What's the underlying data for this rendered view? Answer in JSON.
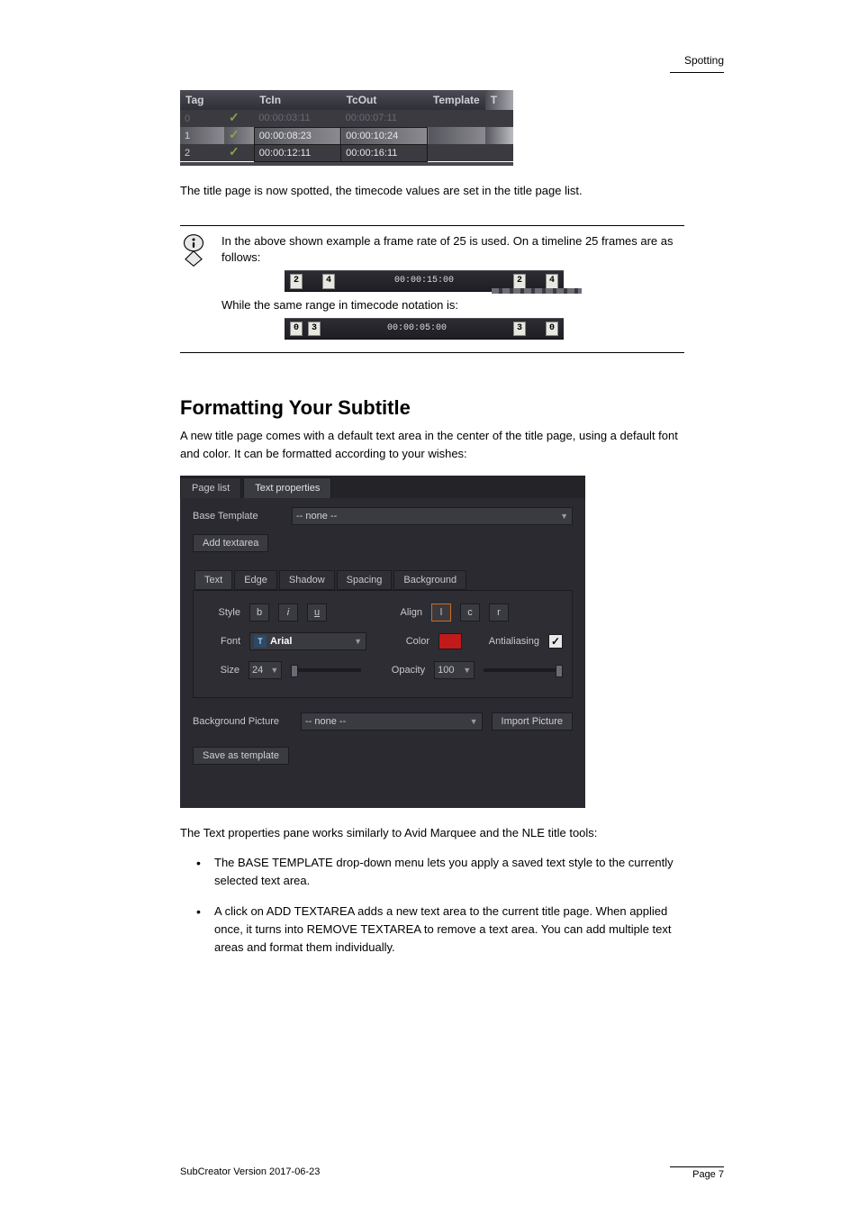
{
  "header": {
    "label": "Spotting"
  },
  "page_list": {
    "headers": [
      "Tag",
      "",
      "TcIn",
      "TcOut",
      "Template",
      "T"
    ],
    "rows": [
      {
        "tag": "0",
        "tcin": "00:00:03:11",
        "tcout": "00:00:07:11"
      },
      {
        "tag": "1",
        "tcin": "00:00:08:23",
        "tcout": "00:00:10:24"
      },
      {
        "tag": "2",
        "tcin": "00:00:12:11",
        "tcout": "00:00:16:11"
      }
    ]
  },
  "note": {
    "line1": "In the above shown example a frame rate of 25 is used. On a timeline 25 frames are as follows:",
    "line2": "While the same range in timecode notation is:"
  },
  "timeline1": {
    "left1": "2",
    "leftpad": "",
    "left2": "4",
    "center": "00:00:15:00",
    "right1": "2",
    "right2": "4"
  },
  "timeline2": {
    "left1": "0",
    "left2": "3",
    "center": "00:00:05:00",
    "right1": "3",
    "right2": "0"
  },
  "section_heading": "Formatting Your Subtitle",
  "paragraphs": {
    "p1": "A new title page comes with a default text area in the center of the title page, using a default font and color. It can be formatted according to your wishes:",
    "p2": "The Text properties pane works similarly to Avid Marquee and the NLE title tools:"
  },
  "text_properties": {
    "tabs": {
      "page_list": "Page list",
      "text_properties": "Text properties"
    },
    "base_template_label": "Base Template",
    "base_template_value": "-- none --",
    "add_textarea": "Add textarea",
    "subtabs": {
      "text": "Text",
      "edge": "Edge",
      "shadow": "Shadow",
      "spacing": "Spacing",
      "background": "Background"
    },
    "style": {
      "label": "Style",
      "b": "b",
      "i": "i",
      "u": "u"
    },
    "align": {
      "label": "Align",
      "l": "l",
      "c": "c",
      "r": "r"
    },
    "font": {
      "label": "Font",
      "value": "Arial"
    },
    "color": {
      "label": "Color"
    },
    "antialiasing_label": "Antialiasing",
    "size": {
      "label": "Size",
      "value": "24"
    },
    "opacity": {
      "label": "Opacity",
      "value": "100"
    },
    "bg_picture_label": "Background Picture",
    "bg_picture_value": "-- none --",
    "import_picture": "Import Picture",
    "save_as_template": "Save as template"
  },
  "bullets": {
    "b1a": "The BASE TEMPLATE drop-down menu lets you apply a saved text style to the currently selected text area.",
    "b2a": "A click on ADD TEXTAREA adds a new text area to the current title page. When applied once, it turns into REMOVE TEXTAREA to remove a text area. You can add multiple text areas and format them individually."
  },
  "footer": {
    "left": "SubCreator Version 2017-06-23",
    "right_label": "Page",
    "right_value": "7"
  }
}
